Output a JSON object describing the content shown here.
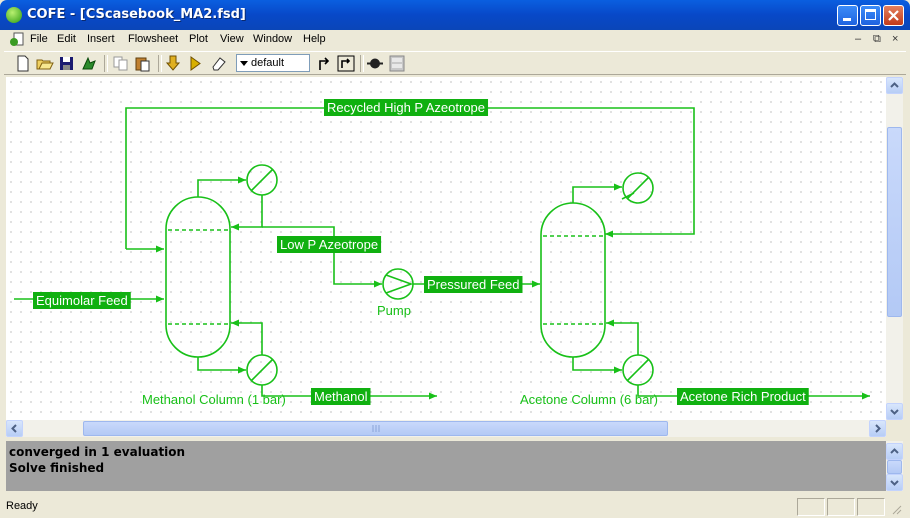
{
  "window": {
    "title": "COFE - [CScasebook_MA2.fsd]"
  },
  "menu": {
    "items": [
      "File",
      "Edit",
      "Insert",
      "Flowsheet",
      "Plot",
      "View",
      "Window",
      "Help"
    ]
  },
  "toolbar": {
    "config_select": "default",
    "icons": [
      "new-icon",
      "open-icon",
      "save-icon",
      "properties-icon",
      "copy-icon",
      "paste-icon",
      "import-icon",
      "run-icon",
      "erase-icon",
      "step-icon",
      "stream-icon",
      "unit-icon",
      "panel-icon"
    ]
  },
  "flowsheet": {
    "streams": {
      "recycle": "Recycled High P Azeotrope",
      "low_p": "Low P Azeotrope",
      "feed": "Equimolar Feed",
      "pressured": "Pressured Feed",
      "methanol": "Methanol",
      "acetone": "Acetone Rich Product"
    },
    "units": {
      "pump": "Pump",
      "column1": "Methanol Column (1 bar)",
      "column2": "Acetone Column (6 bar)"
    },
    "line_color": "#18c018",
    "label_bg": "#10b010"
  },
  "output": {
    "lines": [
      "converged in 1 evaluation",
      "Solve finished"
    ]
  },
  "status": {
    "text": "Ready"
  }
}
